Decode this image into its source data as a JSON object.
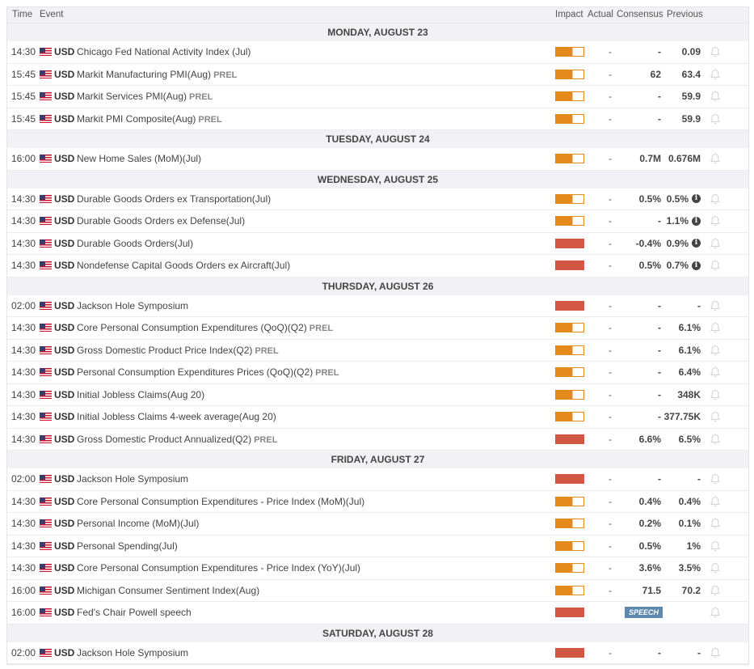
{
  "header": {
    "time": "Time",
    "event": "Event",
    "impact": "Impact",
    "actual": "Actual",
    "consensus": "Consensus",
    "previous": "Previous"
  },
  "colors": {
    "medium": "#e4891b",
    "high": "#d35745",
    "speech": "#5f88ae"
  },
  "days": [
    {
      "label": "MONDAY, AUGUST 23",
      "events": [
        {
          "time": "14:30",
          "currency": "USD",
          "name": "Chicago Fed National Activity Index (Jul)",
          "tag": "",
          "impact": "medium",
          "actual": "-",
          "consensus": "-",
          "previous": "0.09",
          "info": false
        },
        {
          "time": "15:45",
          "currency": "USD",
          "name": "Markit Manufacturing PMI(Aug)",
          "tag": "PREL",
          "impact": "medium",
          "actual": "-",
          "consensus": "62",
          "previous": "63.4",
          "info": false
        },
        {
          "time": "15:45",
          "currency": "USD",
          "name": "Markit Services PMI(Aug)",
          "tag": "PREL",
          "impact": "medium",
          "actual": "-",
          "consensus": "-",
          "previous": "59.9",
          "info": false
        },
        {
          "time": "15:45",
          "currency": "USD",
          "name": "Markit PMI Composite(Aug)",
          "tag": "PREL",
          "impact": "medium",
          "actual": "-",
          "consensus": "-",
          "previous": "59.9",
          "info": false
        }
      ]
    },
    {
      "label": "TUESDAY, AUGUST 24",
      "events": [
        {
          "time": "16:00",
          "currency": "USD",
          "name": "New Home Sales (MoM)(Jul)",
          "tag": "",
          "impact": "medium",
          "actual": "-",
          "consensus": "0.7M",
          "previous": "0.676M",
          "info": false
        }
      ]
    },
    {
      "label": "WEDNESDAY, AUGUST 25",
      "events": [
        {
          "time": "14:30",
          "currency": "USD",
          "name": "Durable Goods Orders ex Transportation(Jul)",
          "tag": "",
          "impact": "medium",
          "actual": "-",
          "consensus": "0.5%",
          "previous": "0.5%",
          "info": true
        },
        {
          "time": "14:30",
          "currency": "USD",
          "name": "Durable Goods Orders ex Defense(Jul)",
          "tag": "",
          "impact": "medium",
          "actual": "-",
          "consensus": "-",
          "previous": "1.1%",
          "info": true
        },
        {
          "time": "14:30",
          "currency": "USD",
          "name": "Durable Goods Orders(Jul)",
          "tag": "",
          "impact": "high",
          "actual": "-",
          "consensus": "-0.4%",
          "previous": "0.9%",
          "info": true
        },
        {
          "time": "14:30",
          "currency": "USD",
          "name": "Nondefense Capital Goods Orders ex Aircraft(Jul)",
          "tag": "",
          "impact": "high",
          "actual": "-",
          "consensus": "0.5%",
          "previous": "0.7%",
          "info": true
        }
      ]
    },
    {
      "label": "THURSDAY, AUGUST 26",
      "events": [
        {
          "time": "02:00",
          "currency": "USD",
          "name": "Jackson Hole Symposium",
          "tag": "",
          "impact": "high",
          "actual": "-",
          "consensus": "-",
          "previous": "-",
          "info": false
        },
        {
          "time": "14:30",
          "currency": "USD",
          "name": "Core Personal Consumption Expenditures (QoQ)(Q2)",
          "tag": "PREL",
          "impact": "medium",
          "actual": "-",
          "consensus": "-",
          "previous": "6.1%",
          "info": false
        },
        {
          "time": "14:30",
          "currency": "USD",
          "name": "Gross Domestic Product Price Index(Q2)",
          "tag": "PREL",
          "impact": "medium",
          "actual": "-",
          "consensus": "-",
          "previous": "6.1%",
          "info": false
        },
        {
          "time": "14:30",
          "currency": "USD",
          "name": "Personal Consumption Expenditures Prices (QoQ)(Q2)",
          "tag": "PREL",
          "impact": "medium",
          "actual": "-",
          "consensus": "-",
          "previous": "6.4%",
          "info": false
        },
        {
          "time": "14:30",
          "currency": "USD",
          "name": "Initial Jobless Claims(Aug 20)",
          "tag": "",
          "impact": "medium",
          "actual": "-",
          "consensus": "-",
          "previous": "348K",
          "info": false
        },
        {
          "time": "14:30",
          "currency": "USD",
          "name": "Initial Jobless Claims 4-week average(Aug 20)",
          "tag": "",
          "impact": "medium",
          "actual": "-",
          "consensus": "-",
          "previous": "377.75K",
          "info": false
        },
        {
          "time": "14:30",
          "currency": "USD",
          "name": "Gross Domestic Product Annualized(Q2)",
          "tag": "PREL",
          "impact": "high",
          "actual": "-",
          "consensus": "6.6%",
          "previous": "6.5%",
          "info": false
        }
      ]
    },
    {
      "label": "FRIDAY, AUGUST 27",
      "events": [
        {
          "time": "02:00",
          "currency": "USD",
          "name": "Jackson Hole Symposium",
          "tag": "",
          "impact": "high",
          "actual": "-",
          "consensus": "-",
          "previous": "-",
          "info": false
        },
        {
          "time": "14:30",
          "currency": "USD",
          "name": "Core Personal Consumption Expenditures - Price Index (MoM)(Jul)",
          "tag": "",
          "impact": "medium",
          "actual": "-",
          "consensus": "0.4%",
          "previous": "0.4%",
          "info": false
        },
        {
          "time": "14:30",
          "currency": "USD",
          "name": "Personal Income (MoM)(Jul)",
          "tag": "",
          "impact": "medium",
          "actual": "-",
          "consensus": "0.2%",
          "previous": "0.1%",
          "info": false
        },
        {
          "time": "14:30",
          "currency": "USD",
          "name": "Personal Spending(Jul)",
          "tag": "",
          "impact": "medium",
          "actual": "-",
          "consensus": "0.5%",
          "previous": "1%",
          "info": false
        },
        {
          "time": "14:30",
          "currency": "USD",
          "name": "Core Personal Consumption Expenditures - Price Index (YoY)(Jul)",
          "tag": "",
          "impact": "medium",
          "actual": "-",
          "consensus": "3.6%",
          "previous": "3.5%",
          "info": false
        },
        {
          "time": "16:00",
          "currency": "USD",
          "name": "Michigan Consumer Sentiment Index(Aug)",
          "tag": "",
          "impact": "medium",
          "actual": "-",
          "consensus": "71.5",
          "previous": "70.2",
          "info": false
        },
        {
          "time": "16:00",
          "currency": "USD",
          "name": "Fed's Chair Powell speech",
          "tag": "",
          "impact": "high",
          "speech": "SPEECH",
          "info": false
        }
      ]
    },
    {
      "label": "SATURDAY, AUGUST 28",
      "events": [
        {
          "time": "02:00",
          "currency": "USD",
          "name": "Jackson Hole Symposium",
          "tag": "",
          "impact": "high",
          "actual": "-",
          "consensus": "-",
          "previous": "-",
          "info": false
        }
      ]
    }
  ]
}
